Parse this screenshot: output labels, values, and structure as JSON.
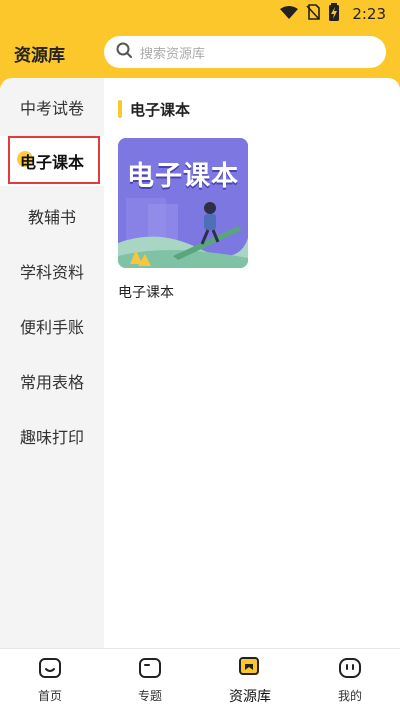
{
  "status_bar": {
    "time": "2:23"
  },
  "header": {
    "title": "资源库"
  },
  "search": {
    "placeholder": "搜索资源库"
  },
  "sidebar": {
    "items": [
      {
        "label": "中考试卷",
        "active": false
      },
      {
        "label": "电子课本",
        "active": true
      },
      {
        "label": "教辅书",
        "active": false
      },
      {
        "label": "学科资料",
        "active": false
      },
      {
        "label": "便利手账",
        "active": false
      },
      {
        "label": "常用表格",
        "active": false
      },
      {
        "label": "趣味打印",
        "active": false
      }
    ]
  },
  "main": {
    "section_title": "电子课本",
    "cards": [
      {
        "thumb_text": "电子课本",
        "caption": "电子课本"
      }
    ]
  },
  "bottom_nav": {
    "items": [
      {
        "label": "首页",
        "icon": "home-icon"
      },
      {
        "label": "专题",
        "icon": "topic-icon"
      },
      {
        "label": "资源库",
        "icon": "library-icon",
        "active": true
      },
      {
        "label": "我的",
        "icon": "profile-icon"
      }
    ]
  },
  "colors": {
    "accent": "#fcc72a",
    "highlight": "#e23b3b"
  }
}
